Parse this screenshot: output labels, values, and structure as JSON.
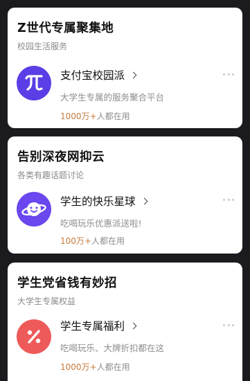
{
  "sections": [
    {
      "title": "Z世代专属聚集地",
      "subtitle": "校园生活服务",
      "app_name": "支付宝校园派",
      "description": "大学生专属的服务聚合平台",
      "users_count": "1000万+",
      "users_suffix": "人都在用",
      "icon": "pi-icon",
      "icon_color": "#5b3ee6"
    },
    {
      "title": "告别深夜网抑云",
      "subtitle": "各类有趣话题讨论",
      "app_name": "学生的快乐星球",
      "description": "吃喝玩乐优惠派送啦!",
      "users_count": "100万+",
      "users_suffix": "人都在用",
      "icon": "smiling-planet-icon",
      "icon_color": "#6a47ee"
    },
    {
      "title": "学生党省钱有妙招",
      "subtitle": "大学生专属权益",
      "app_name": "学生专属福利",
      "description": "吃喝玩乐、大牌折扣都在这",
      "users_count": "1000万+",
      "users_suffix": "人都在用",
      "icon": "percent-icon",
      "icon_color": "#ee5a5a"
    }
  ]
}
